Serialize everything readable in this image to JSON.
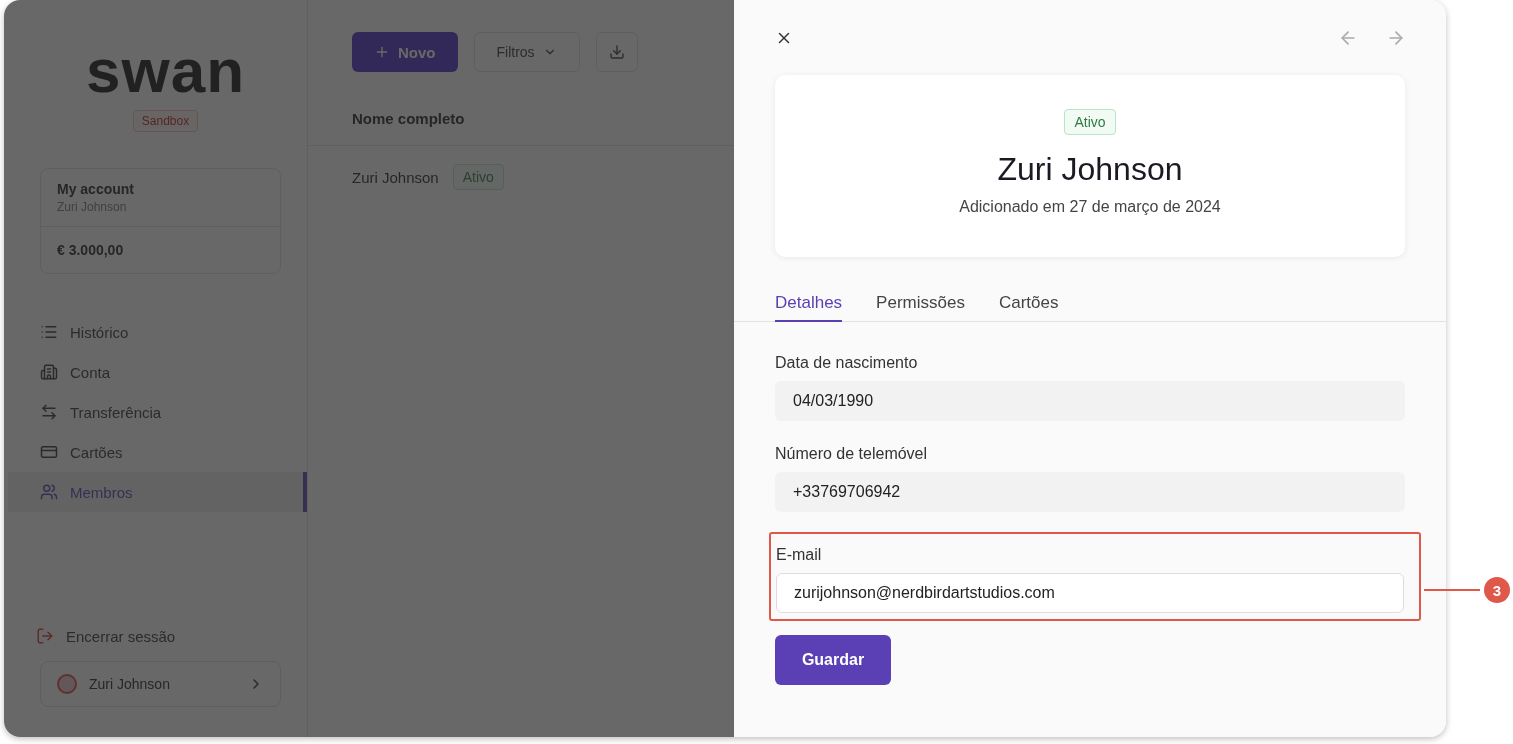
{
  "sidebar": {
    "logo": "swan",
    "environment_badge": "Sandbox",
    "account": {
      "title": "My account",
      "subtitle": "Zuri Johnson",
      "balance": "€ 3.000,00"
    },
    "nav_items": [
      {
        "label": "Histórico",
        "kind": "history",
        "selected": false
      },
      {
        "label": "Conta",
        "kind": "account",
        "selected": false
      },
      {
        "label": "Transferência",
        "kind": "transfer",
        "selected": false
      },
      {
        "label": "Cartões",
        "kind": "cards",
        "selected": false
      },
      {
        "label": "Membros",
        "kind": "members",
        "selected": true
      }
    ],
    "logout": "Encerrar sessão",
    "user": {
      "name": "Zuri Johnson"
    }
  },
  "members_list": {
    "new_button": "Novo",
    "filters_button": "Filtros",
    "column": "Nome completo",
    "rows": [
      {
        "name": "Zuri Johnson",
        "status": "Ativo"
      }
    ]
  },
  "detail_panel": {
    "status": "Ativo",
    "name": "Zuri Johnson",
    "added": "Adicionado em 27 de março de 2024",
    "tabs": [
      {
        "label": "Detalhes",
        "selected": true
      },
      {
        "label": "Permissões",
        "selected": false
      },
      {
        "label": "Cartões",
        "selected": false
      }
    ],
    "fields": [
      {
        "label": "Data de nascimento",
        "value": "04/03/1990",
        "editable": false,
        "highlighted": false
      },
      {
        "label": "Número de telemóvel",
        "value": "+33769706942",
        "editable": false,
        "highlighted": false
      },
      {
        "label": "E-mail",
        "value": "zurijohnson@nerdbirdartstudios.com",
        "editable": true,
        "highlighted": true
      }
    ],
    "save_button": "Guardar"
  },
  "callout": {
    "number": "3"
  }
}
